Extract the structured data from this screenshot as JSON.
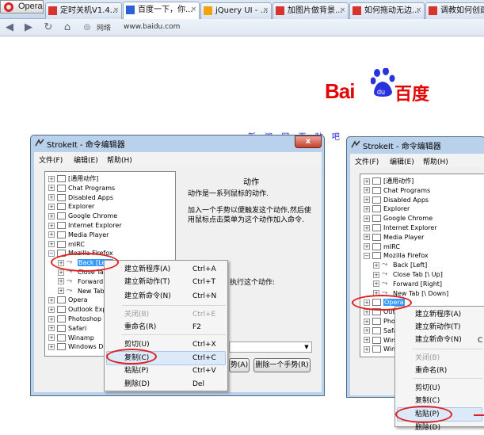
{
  "browser": {
    "menu_button": "Opera",
    "tabs": [
      {
        "label": "定时关机V1.4...",
        "icon_color": "#d9342b"
      },
      {
        "label": "百度一下，你...",
        "icon_color": "#2b5fd9"
      },
      {
        "label": "jQuery UI - ...",
        "icon_color": "#f0a30a"
      },
      {
        "label": "加图片做背景...",
        "icon_color": "#d9342b"
      },
      {
        "label": "如何拖动无边...",
        "icon_color": "#d9342b"
      },
      {
        "label": "调教如何创建",
        "icon_color": "#d9342b"
      }
    ],
    "address_label": "网络",
    "address": "www.baidu.com"
  },
  "page": {
    "logo_latin": "Bai",
    "logo_du": "du",
    "logo_cn": "百度",
    "links": "新 闻  网 页  贴 吧"
  },
  "left_window": {
    "title": "StrokeIt - 命令编辑器",
    "close": "x",
    "menu": [
      "文件(F)",
      "编辑(E)",
      "帮助(H)"
    ],
    "tree": [
      {
        "label": "[通用动作]"
      },
      {
        "label": "Chat Programs"
      },
      {
        "label": "Disabled Apps"
      },
      {
        "label": "Explorer"
      },
      {
        "label": "Google Chrome"
      },
      {
        "label": "Internet Explorer"
      },
      {
        "label": "Media Player"
      },
      {
        "label": "mIRC"
      },
      {
        "label": "Mozilla Firefox"
      },
      {
        "label": "Back [Left]"
      },
      {
        "label": "Close Tab"
      },
      {
        "label": "Forward ["
      },
      {
        "label": "New Tab"
      },
      {
        "label": "Opera"
      },
      {
        "label": "Outlook Expre"
      },
      {
        "label": "Photoshop"
      },
      {
        "label": "Safari"
      },
      {
        "label": "Winamp"
      },
      {
        "label": "Windows Des"
      }
    ],
    "panel_title": "动作",
    "panel_text1": "动作是一系列鼠标的动作.",
    "panel_text2a": "加入一个手势以便触发这个动作,然后使",
    "panel_text2b": "用鼠标点击菜单为这个动作加入命令.",
    "exec_label": "执行这个动作:",
    "btn_add": "势(A)",
    "btn_remove": "删除一个手势(R)"
  },
  "left_menu": {
    "items": [
      {
        "label": "建立新程序(A)",
        "shortcut": "Ctrl+A",
        "disabled": false
      },
      {
        "label": "建立新动作(T)",
        "shortcut": "Ctrl+T",
        "disabled": false
      },
      {
        "label": "建立新命令(N)",
        "shortcut": "Ctrl+N",
        "disabled": false
      },
      {
        "label": "关闭(B)",
        "shortcut": "Ctrl+E",
        "disabled": true
      },
      {
        "label": "重命名(R)",
        "shortcut": "F2",
        "disabled": false
      },
      {
        "label": "剪切(U)",
        "shortcut": "Ctrl+X",
        "disabled": false
      },
      {
        "label": "复制(C)",
        "shortcut": "Ctrl+C",
        "disabled": false
      },
      {
        "label": "粘贴(P)",
        "shortcut": "Ctrl+V",
        "disabled": false
      },
      {
        "label": "删除(D)",
        "shortcut": "Del",
        "disabled": false
      }
    ]
  },
  "right_window": {
    "title": "StrokeIt - 命令编辑器",
    "menu": [
      "文件(F)",
      "编辑(E)",
      "帮助(H)"
    ],
    "tree": [
      {
        "label": "[通用动作]"
      },
      {
        "label": "Chat Programs"
      },
      {
        "label": "Disabled Apps"
      },
      {
        "label": "Explorer"
      },
      {
        "label": "Google Chrome"
      },
      {
        "label": "Internet Explorer"
      },
      {
        "label": "Media Player"
      },
      {
        "label": "mIRC"
      },
      {
        "label": "Mozilla Firefox"
      },
      {
        "label": "Back [Left]"
      },
      {
        "label": "Close Tab [\\ Up]"
      },
      {
        "label": "Forward [Right]"
      },
      {
        "label": "New Tab [\\ Down]"
      },
      {
        "label": "Opera"
      },
      {
        "label": "Outl"
      },
      {
        "label": "Phot"
      },
      {
        "label": "Safa"
      },
      {
        "label": "Wina"
      },
      {
        "label": "Wind"
      }
    ]
  },
  "right_menu": {
    "items": [
      {
        "label": "建立新程序(A)",
        "disabled": false
      },
      {
        "label": "建立新动作(T)",
        "disabled": false
      },
      {
        "label": "建立新命令(N)",
        "disabled": false
      },
      {
        "label": "关闭(B)",
        "disabled": true
      },
      {
        "label": "重命名(R)",
        "disabled": false
      },
      {
        "label": "剪切(U)",
        "disabled": false
      },
      {
        "label": "复制(C)",
        "disabled": false
      },
      {
        "label": "粘贴(P)",
        "disabled": false
      },
      {
        "label": "删除(D)",
        "disabled": false
      }
    ],
    "shortcut_partial": "C"
  },
  "colors": {
    "annotation": "#e02020",
    "selection": "#3399ff",
    "baidu_red": "#e10602",
    "baidu_blue": "#2932e1"
  }
}
